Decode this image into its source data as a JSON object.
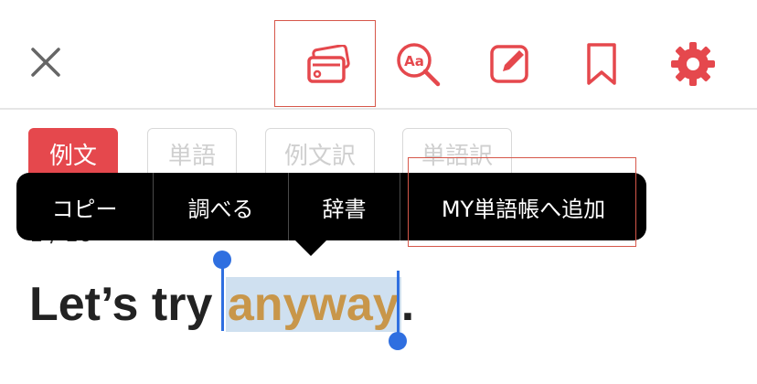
{
  "toolbar": {
    "icons": [
      "close-icon",
      "flashcards-icon",
      "dictionary-search-icon",
      "edit-note-icon",
      "bookmark-icon",
      "settings-gear-icon"
    ],
    "accent_color": "#e5484d"
  },
  "tabs": [
    {
      "label": "例文",
      "active": true
    },
    {
      "label": "単語",
      "active": false
    },
    {
      "label": "例文訳",
      "active": false
    },
    {
      "label": "単語訳",
      "active": false
    }
  ],
  "counter": "1 / 10",
  "context_menu": {
    "items": [
      "コピー",
      "調べる",
      "辞書",
      "MY単語帳へ追加"
    ]
  },
  "sentence": {
    "before": "Let’s try ",
    "selected": "anyway",
    "after": "."
  }
}
